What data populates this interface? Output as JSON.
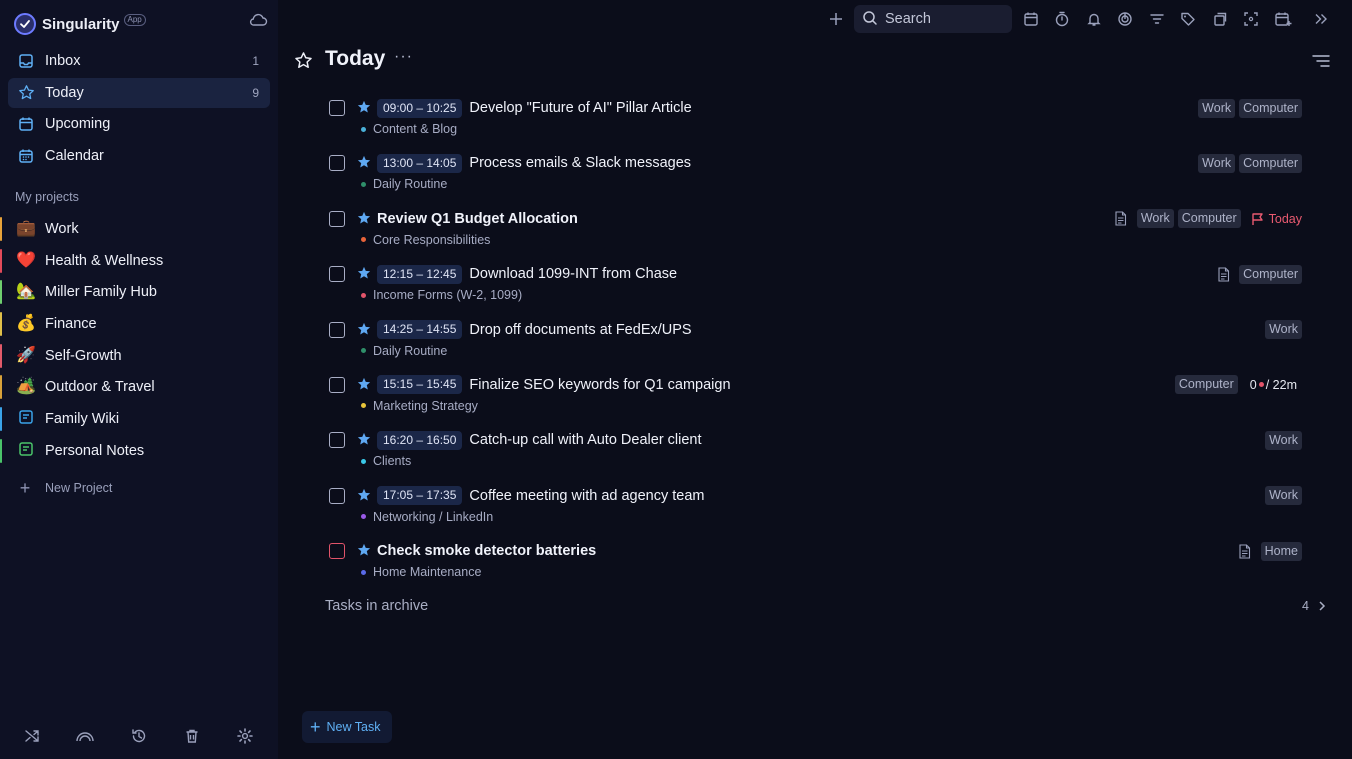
{
  "app": {
    "name": "Singularity",
    "badge": "App"
  },
  "colors": {
    "accent": "#5fb0f5",
    "star": "#5fa8f2",
    "today_red": "#e95a70",
    "bg": "#0b0d1a",
    "sidebar_bg": "#0e1124"
  },
  "nav": [
    {
      "label": "Inbox",
      "count": "1",
      "icon": "inbox-icon"
    },
    {
      "label": "Today",
      "count": "9",
      "icon": "star-icon"
    },
    {
      "label": "Upcoming",
      "count": "",
      "icon": "calendar-icon"
    },
    {
      "label": "Calendar",
      "count": "",
      "icon": "calendar-grid-icon"
    }
  ],
  "projects_title": "My projects",
  "projects": [
    {
      "label": "Work",
      "emoji": "💼",
      "color": "#e8a33a"
    },
    {
      "label": "Health & Wellness",
      "emoji": "❤️",
      "color": "#e24a5a"
    },
    {
      "label": "Miller Family Hub",
      "emoji": "🏡",
      "color": "#6fcf6f"
    },
    {
      "label": "Finance",
      "emoji": "💰",
      "color": "#e0c04a"
    },
    {
      "label": "Self-Growth",
      "emoji": "🚀",
      "color": "#e25a6a"
    },
    {
      "label": "Outdoor & Travel",
      "emoji": "🏕️",
      "color": "#d8a23a"
    },
    {
      "label": "Family Wiki",
      "emoji": "📝",
      "color": "#3aa3e8"
    },
    {
      "label": "Personal Notes",
      "emoji": "📝",
      "color": "#4ac46a"
    }
  ],
  "new_project": "New Project",
  "search": {
    "placeholder": "Search"
  },
  "main": {
    "title": "Today",
    "more": "···"
  },
  "tasks": [
    {
      "time": "09:00 – 10:25",
      "title": "Develop \"Future of AI\" Pillar Article",
      "project": "Content & Blog",
      "dot": "#4ab0d8",
      "tags": [
        "Work",
        "Computer"
      ],
      "note": false,
      "flag": "",
      "pomo": ""
    },
    {
      "time": "13:00 – 14:05",
      "title": "Process emails & Slack messages",
      "project": "Daily Routine",
      "dot": "#2f8f6a",
      "tags": [
        "Work",
        "Computer"
      ],
      "note": false,
      "flag": "",
      "pomo": ""
    },
    {
      "time": "",
      "title": "Review Q1 Budget Allocation",
      "project": "Core Responsibilities",
      "dot": "#e8633a",
      "tags": [
        "Work",
        "Computer"
      ],
      "note": true,
      "flag": "Today",
      "pomo": ""
    },
    {
      "time": "12:15 – 12:45",
      "title": "Download 1099-INT from Chase",
      "project": "Income Forms (W-2, 1099)",
      "dot": "#e2546a",
      "tags": [
        "Computer"
      ],
      "note": true,
      "flag": "",
      "pomo": ""
    },
    {
      "time": "14:25 – 14:55",
      "title": "Drop off documents at FedEx/UPS",
      "project": "Daily Routine",
      "dot": "#2f8f6a",
      "tags": [
        "Work"
      ],
      "note": false,
      "flag": "",
      "pomo": ""
    },
    {
      "time": "15:15 – 15:45",
      "title": "Finalize SEO keywords for Q1 campaign",
      "project": "Marketing Strategy",
      "dot": "#e8c43a",
      "tags": [
        "Computer"
      ],
      "note": false,
      "flag": "",
      "pomo": {
        "count": "0",
        "duration": "/ 22m"
      }
    },
    {
      "time": "16:20 – 16:50",
      "title": "Catch-up call with Auto Dealer client",
      "project": "Clients",
      "dot": "#3ac8e8",
      "tags": [
        "Work"
      ],
      "note": false,
      "flag": "",
      "pomo": ""
    },
    {
      "time": "17:05 – 17:35",
      "title": "Coffee meeting with ad agency team",
      "project": "Networking / LinkedIn",
      "dot": "#9a5ae8",
      "tags": [
        "Work"
      ],
      "note": false,
      "flag": "",
      "pomo": ""
    },
    {
      "time": "",
      "title": "Check smoke detector batteries",
      "project": "Home Maintenance",
      "dot": "#5a6ae8",
      "tags": [
        "Home"
      ],
      "note": true,
      "flag": "",
      "pomo": "",
      "priority": "red"
    }
  ],
  "archive": {
    "label": "Tasks in archive",
    "count": "4"
  },
  "new_task": "New Task"
}
